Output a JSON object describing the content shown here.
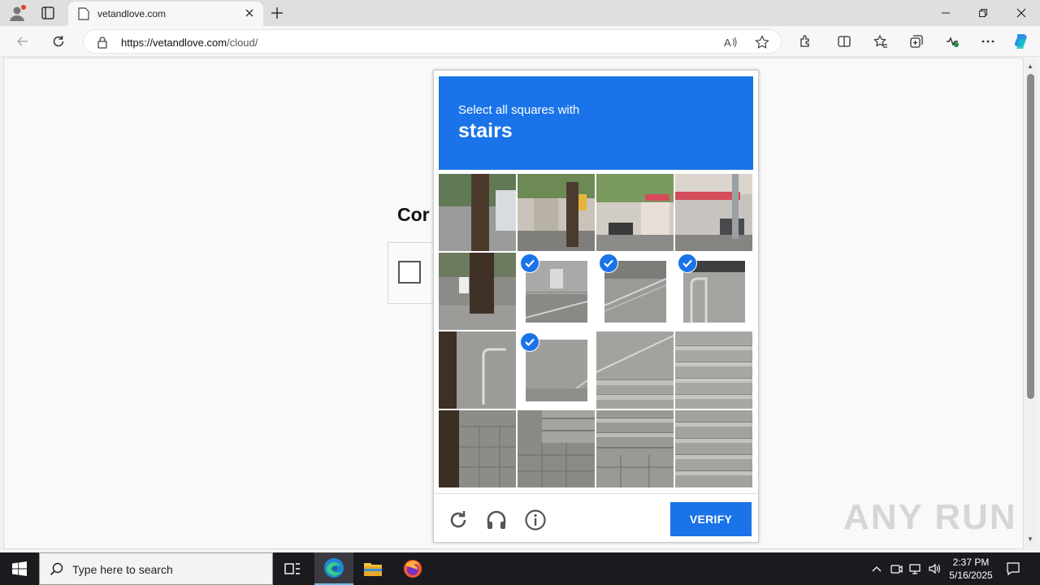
{
  "browser": {
    "tab_title": "vetandlove.com",
    "url_host": "https://vetandlove.com",
    "url_path": "/cloud/"
  },
  "page": {
    "heading_partial": "Cor"
  },
  "captcha": {
    "instruction": "Select all squares with",
    "object": "stairs",
    "verify_label": "VERIFY",
    "selected_tiles": [
      5,
      6,
      7,
      9
    ],
    "header_color": "#1a73e8"
  },
  "watermark": "ANY RUN",
  "taskbar": {
    "search_placeholder": "Type here to search",
    "time": "2:37 PM",
    "date": "5/16/2025"
  }
}
